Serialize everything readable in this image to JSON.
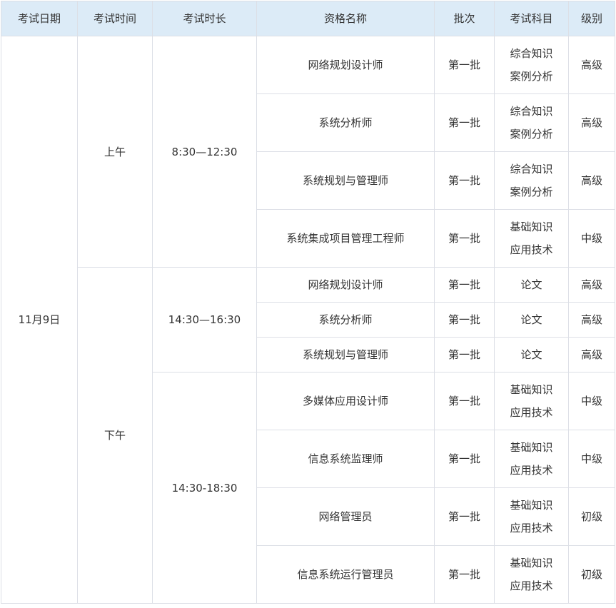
{
  "headers": [
    "考试日期",
    "考试时间",
    "考试时长",
    "资格名称",
    "批次",
    "考试科目",
    "级别"
  ],
  "date": "11月9日",
  "sessions": [
    {
      "label": "上午",
      "duration": "8:30—12:30"
    },
    {
      "label": "下午",
      "durations": [
        "14:30—16:30",
        "14:30-18:30"
      ]
    }
  ],
  "rows": [
    {
      "name": "网络规划设计师",
      "batch": "第一批",
      "subject": [
        "综合知识",
        "案例分析"
      ],
      "level": "高级"
    },
    {
      "name": "系统分析师",
      "batch": "第一批",
      "subject": [
        "综合知识",
        "案例分析"
      ],
      "level": "高级"
    },
    {
      "name": "系统规划与管理师",
      "batch": "第一批",
      "subject": [
        "综合知识",
        "案例分析"
      ],
      "level": "高级"
    },
    {
      "name": "系统集成项目管理工程师",
      "batch": "第一批",
      "subject": [
        "基础知识",
        "应用技术"
      ],
      "level": "中级"
    },
    {
      "name": "网络规划设计师",
      "batch": "第一批",
      "subject": [
        "论文"
      ],
      "level": "高级"
    },
    {
      "name": "系统分析师",
      "batch": "第一批",
      "subject": [
        "论文"
      ],
      "level": "高级"
    },
    {
      "name": "系统规划与管理师",
      "batch": "第一批",
      "subject": [
        "论文"
      ],
      "level": "高级"
    },
    {
      "name": "多媒体应用设计师",
      "batch": "第一批",
      "subject": [
        "基础知识",
        "应用技术"
      ],
      "level": "中级"
    },
    {
      "name": "信息系统监理师",
      "batch": "第一批",
      "subject": [
        "基础知识",
        "应用技术"
      ],
      "level": "中级"
    },
    {
      "name": "网络管理员",
      "batch": "第一批",
      "subject": [
        "基础知识",
        "应用技术"
      ],
      "level": "初级"
    },
    {
      "name": "信息系统运行管理员",
      "batch": "第一批",
      "subject": [
        "基础知识",
        "应用技术"
      ],
      "level": "初级"
    }
  ]
}
